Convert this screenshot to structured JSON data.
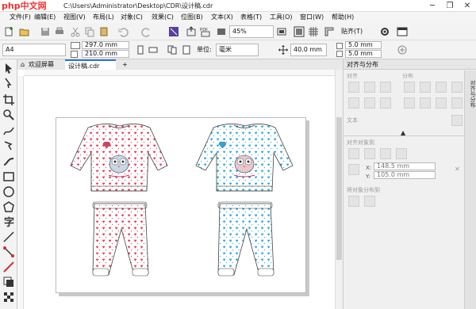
{
  "window": {
    "title": "C:\\Users\\Administrator\\Desktop\\CDR\\设计稿.cdr",
    "watermark_logo": "php中文网",
    "controls": [
      "─",
      "❐",
      "✕"
    ]
  },
  "menu": [
    "文件(F)",
    "编辑(E)",
    "视图(V)",
    "布局(L)",
    "对象(C)",
    "效果(C)",
    "位图(B)",
    "文本(X)",
    "表格(T)",
    "工具(O)",
    "窗口(W)",
    "帮助(H)"
  ],
  "toolbar": {
    "zoom": "45%",
    "paste_label": "贴齐(T)"
  },
  "property_bar": {
    "page_size": "A4",
    "width": "297.0 mm",
    "height": "210.0 mm",
    "unit_label": "单位:",
    "unit_value": "毫米",
    "nudge": "40.0 mm",
    "dup_x": "5.0 mm",
    "dup_y": "5.0 mm"
  },
  "tabs": [
    "欢迎屏幕",
    "设计稿.cdr"
  ],
  "docker": {
    "title": "对齐与分布",
    "align_label": "对齐",
    "distribute_label": "分布",
    "text_label": "文本",
    "align_objects_to_label": "对齐对象到",
    "x_value": "148.5 mm",
    "y_value": "105.0 mm",
    "distribute_objects_to_label": "将对象分布到",
    "side_tab_label": "对齐与分布"
  },
  "colors": {
    "accent_red": "#e23a5a",
    "accent_blue": "#2aa7d8"
  }
}
